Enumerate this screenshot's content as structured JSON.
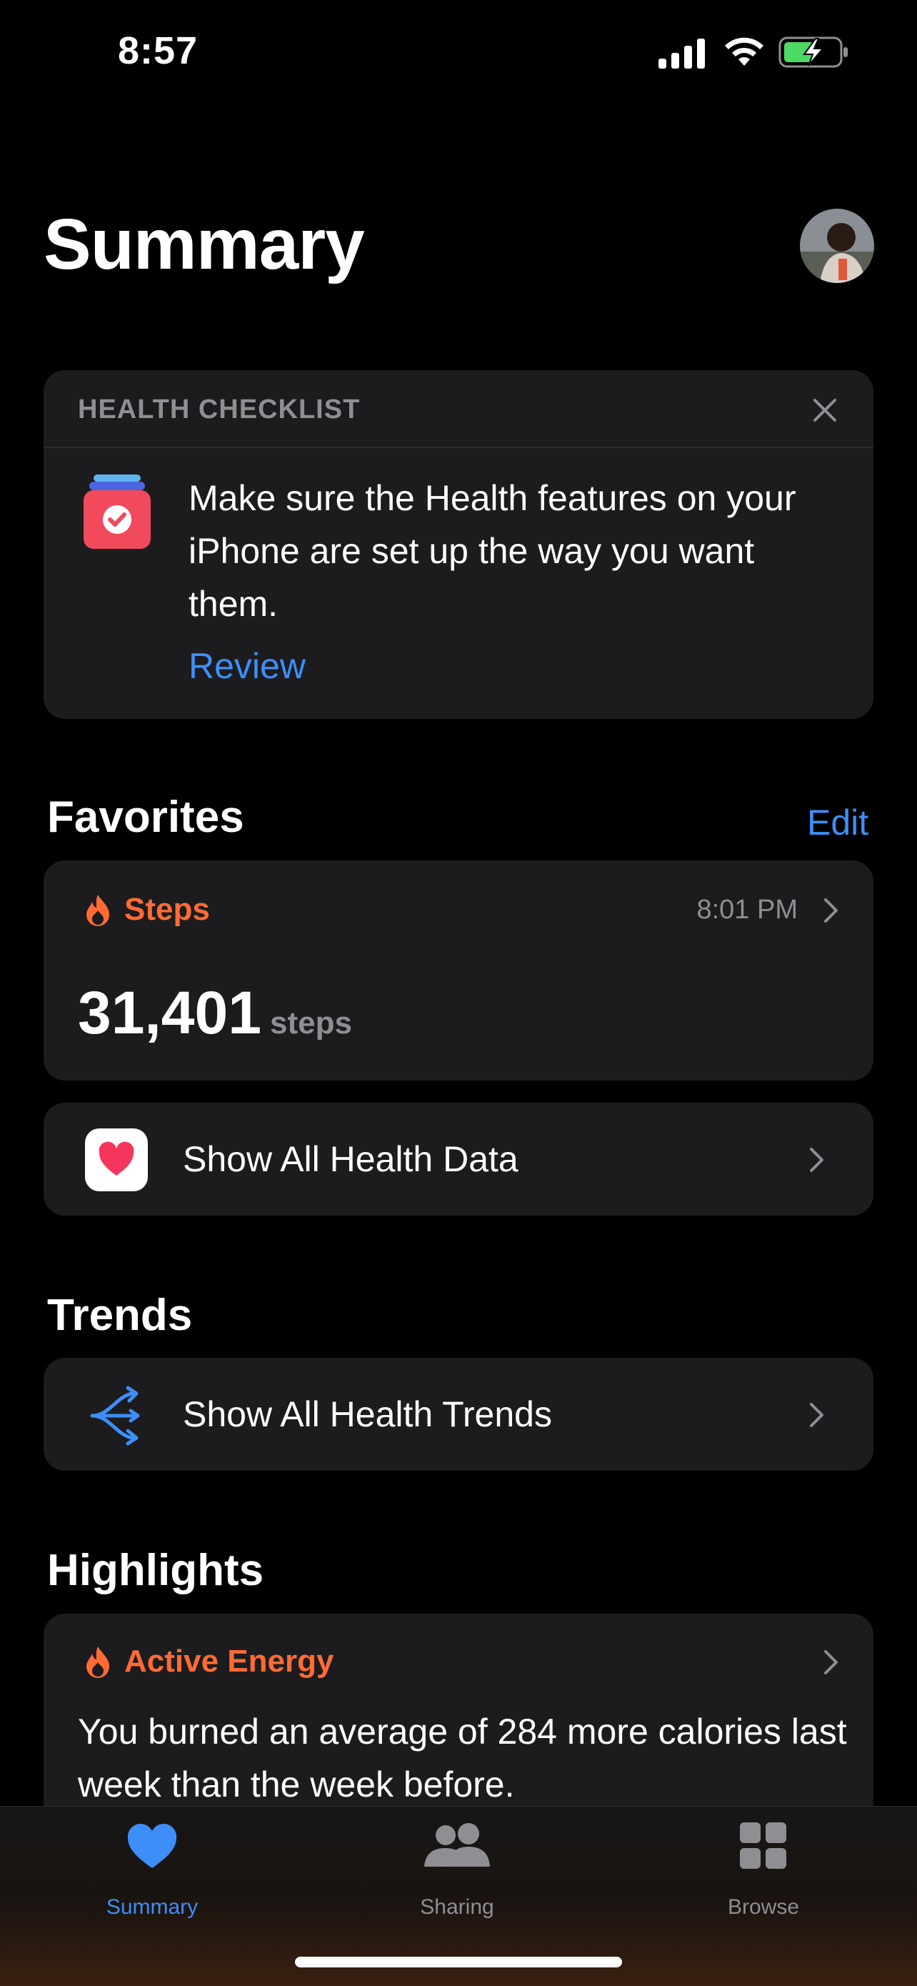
{
  "status_bar": {
    "time": "8:57"
  },
  "header": {
    "title": "Summary"
  },
  "checklist": {
    "heading": "HEALTH CHECKLIST",
    "message": "Make sure the Health features on your iPhone are set up the way you want them.",
    "link": "Review"
  },
  "favorites": {
    "title": "Favorites",
    "edit": "Edit",
    "steps": {
      "title": "Steps",
      "time": "8:01 PM",
      "value": "31,401",
      "unit": "steps"
    },
    "all_data": "Show All Health Data"
  },
  "trends": {
    "title": "Trends",
    "all_trends": "Show All Health Trends"
  },
  "highlights": {
    "title": "Highlights",
    "card_title": "Active Energy",
    "text": "You burned an average of 284 more calories last week than the week before."
  },
  "tabs": [
    {
      "label": "Summary",
      "icon": "heart-icon",
      "active": true
    },
    {
      "label": "Sharing",
      "icon": "people-icon",
      "active": false
    },
    {
      "label": "Browse",
      "icon": "grid-icon",
      "active": false
    }
  ],
  "colors": {
    "accent": "#3e8ef7",
    "activity": "#ff6b35",
    "card": "#1c1c1e",
    "secondary": "#8e8e93"
  }
}
